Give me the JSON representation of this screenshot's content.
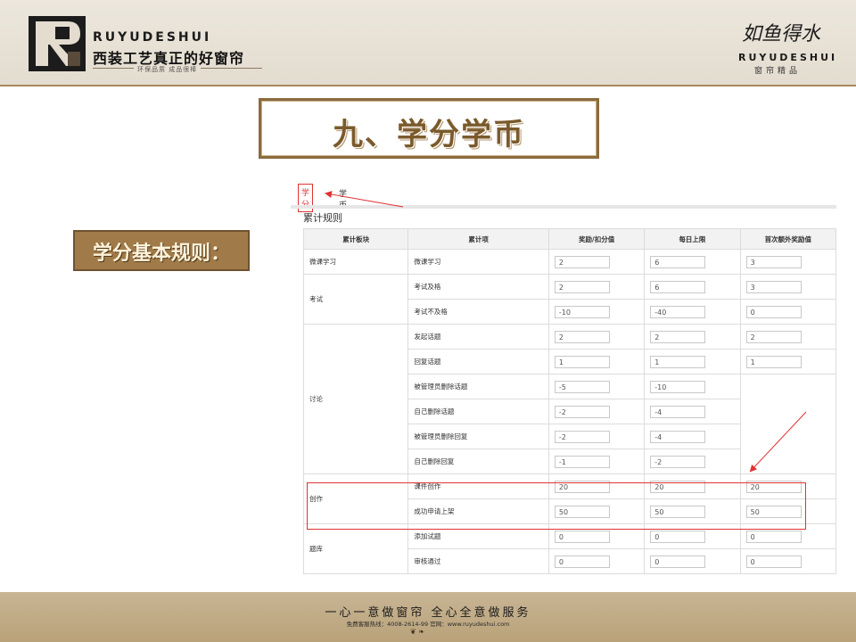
{
  "header": {
    "brand_en": "RUYUDESHUI",
    "slogan": "西装工艺真正的好窗帘",
    "sub_slogan": "环保品质  成品很棒",
    "right_logo_cn": "如鱼得水",
    "right_logo_en": "RUYUDESHUI",
    "right_logo_sub": "窗帘精品"
  },
  "title": "九、学分学币",
  "side_label": "学分基本规则：",
  "tabs": {
    "active": "学分",
    "other": "学币"
  },
  "rules_heading": "累计规则",
  "table": {
    "headers": [
      "累计板块",
      "累计项",
      "奖励/扣分值",
      "每日上限",
      "首次额外奖励值"
    ],
    "groups": [
      {
        "block": "微课学习",
        "rows": [
          {
            "item": "微课学习",
            "reward": "2",
            "limit": "6",
            "first": "3"
          }
        ]
      },
      {
        "block": "考试",
        "rows": [
          {
            "item": "考试及格",
            "reward": "2",
            "limit": "6",
            "first": "3"
          },
          {
            "item": "考试不及格",
            "reward": "-10",
            "limit": "-40",
            "first": "0"
          }
        ]
      },
      {
        "block": "讨论",
        "rows": [
          {
            "item": "发起话题",
            "reward": "2",
            "limit": "2",
            "first": "2"
          },
          {
            "item": "回复话题",
            "reward": "1",
            "limit": "1",
            "first": "1"
          },
          {
            "item": "被管理员删除话题",
            "reward": "-5",
            "limit": "-10",
            "first": ""
          },
          {
            "item": "自己删除话题",
            "reward": "-2",
            "limit": "-4",
            "first": ""
          },
          {
            "item": "被管理员删除回复",
            "reward": "-2",
            "limit": "-4",
            "first": ""
          },
          {
            "item": "自己删除回复",
            "reward": "-1",
            "limit": "-2",
            "first": ""
          }
        ]
      },
      {
        "block": "创作",
        "rows": [
          {
            "item": "课件创作",
            "reward": "20",
            "limit": "20",
            "first": "20"
          },
          {
            "item": "成功申请上架",
            "reward": "50",
            "limit": "50",
            "first": "50"
          }
        ]
      },
      {
        "block": "题库",
        "rows": [
          {
            "item": "添加试题",
            "reward": "0",
            "limit": "0",
            "first": "0"
          },
          {
            "item": "审核通过",
            "reward": "0",
            "limit": "0",
            "first": "0"
          }
        ]
      }
    ]
  },
  "footer": {
    "line1": "一心一意做窗帘  全心全意做服务",
    "line2": "免费客服热线：4008-2614-99  官网：www.ruyudeshui.com"
  }
}
